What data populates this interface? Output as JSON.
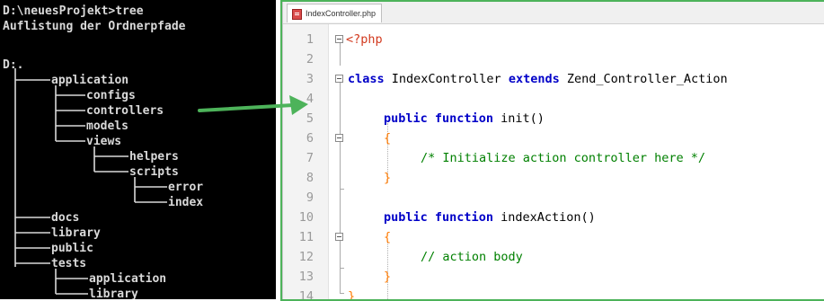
{
  "terminal": {
    "prompt_line": "D:\\neuesProjekt>tree",
    "heading": "Auflistung der Ordnerpfade",
    "root": "D:.",
    "tree": {
      "application": "application",
      "configs": "configs",
      "controllers": "controllers",
      "models": "models",
      "views": "views",
      "helpers": "helpers",
      "scripts": "scripts",
      "error": "error",
      "index": "index",
      "docs": "docs",
      "library": "library",
      "public": "public",
      "tests": "tests",
      "tests_application": "application",
      "tests_library": "library"
    }
  },
  "editor": {
    "tab_label": "IndexController.php",
    "lines": [
      {
        "num": "1"
      },
      {
        "num": "2"
      },
      {
        "num": "3"
      },
      {
        "num": "4"
      },
      {
        "num": "5"
      },
      {
        "num": "6"
      },
      {
        "num": "7"
      },
      {
        "num": "8"
      },
      {
        "num": "9"
      },
      {
        "num": "10"
      },
      {
        "num": "11"
      },
      {
        "num": "12"
      },
      {
        "num": "13"
      },
      {
        "num": "14"
      }
    ],
    "code": {
      "php_open": "<?php",
      "class_kw": "class",
      "class_name": " IndexController ",
      "extends_kw": "extends",
      "parent_class": " Zend_Controller_Action",
      "public_kw": "public",
      "function_kw": "function",
      "init_name": " init",
      "parens": "()",
      "open_brace": "{",
      "close_brace": "}",
      "init_comment": "/* Initialize action controller here */",
      "index_action_name": " indexAction",
      "action_comment": "// action body"
    }
  },
  "colors": {
    "accent_green": "#4db35a",
    "php_tag": "#d23a1f",
    "keyword": "#0000c8",
    "comment": "#008000",
    "brace": "#ff7a00"
  }
}
